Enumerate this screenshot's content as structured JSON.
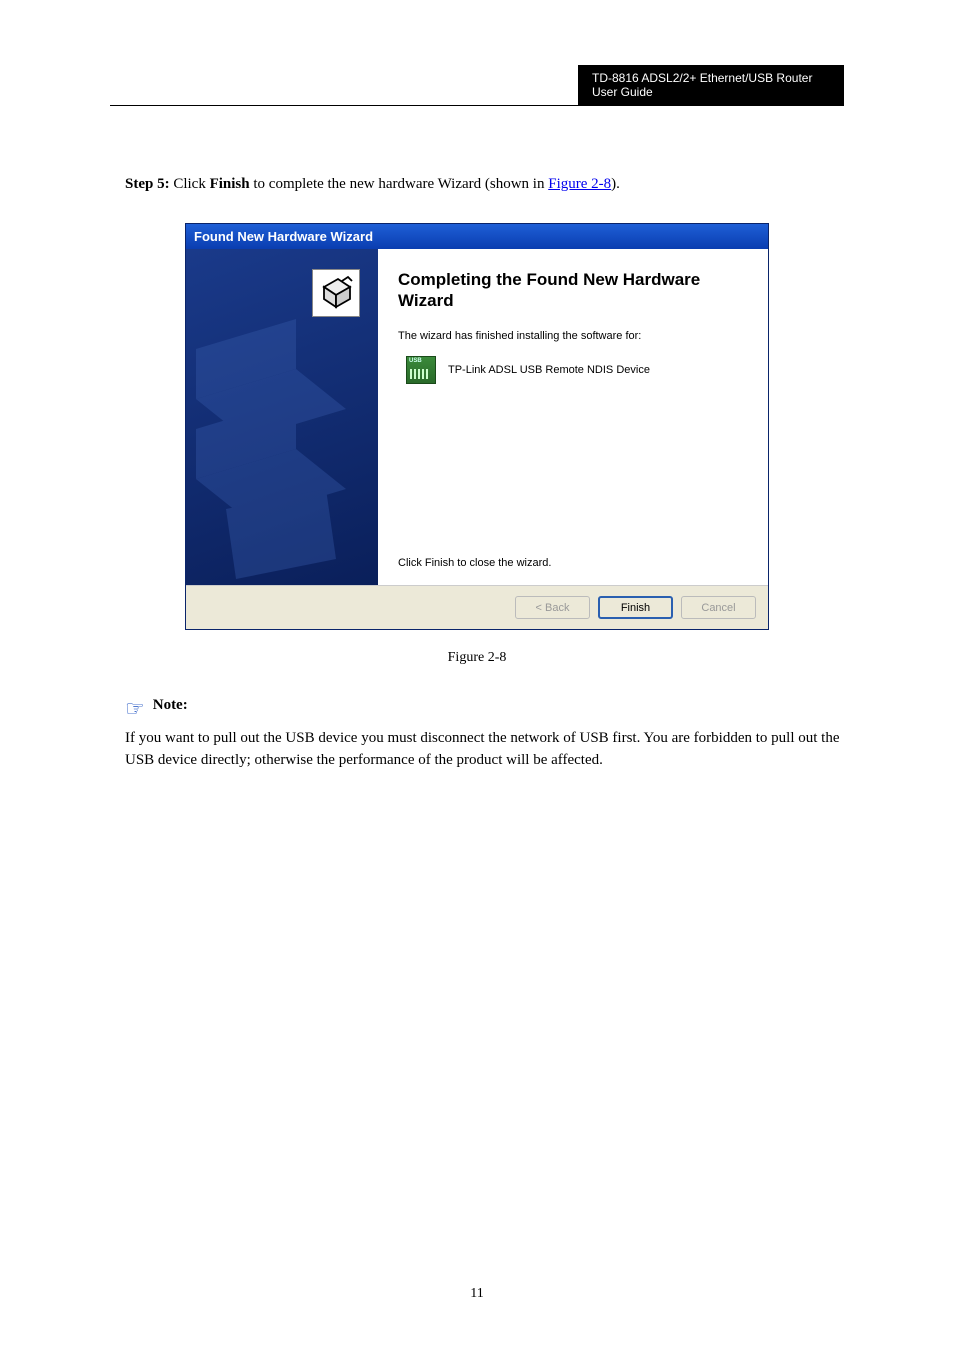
{
  "header": {
    "product": "TD-8816 ADSL2/2+ Ethernet/USB Router User Guide"
  },
  "step5": {
    "prefix": "Step 5: ",
    "text1": "Click ",
    "bold1": "Finish",
    "text2": " to complete the new hardware Wizard (shown in ",
    "link": "Figure 2-8",
    "text3": ")."
  },
  "wizard": {
    "title": "Found New Hardware Wizard",
    "heading": "Completing the Found New Hardware Wizard",
    "subtext": "The wizard has finished installing the software for:",
    "device_name": "TP-Link ADSL USB Remote NDIS Device",
    "closetext": "Click Finish to close the wizard.",
    "btn_back": "< Back",
    "btn_finish": "Finish",
    "btn_cancel": "Cancel"
  },
  "figure_caption": "Figure 2-8",
  "note": {
    "label": "Note:",
    "text": "If you want to pull out the USB device you must disconnect the network of USB first. You are forbidden to pull out the USB device directly; otherwise the performance of the product will be affected."
  },
  "page_number": "11"
}
